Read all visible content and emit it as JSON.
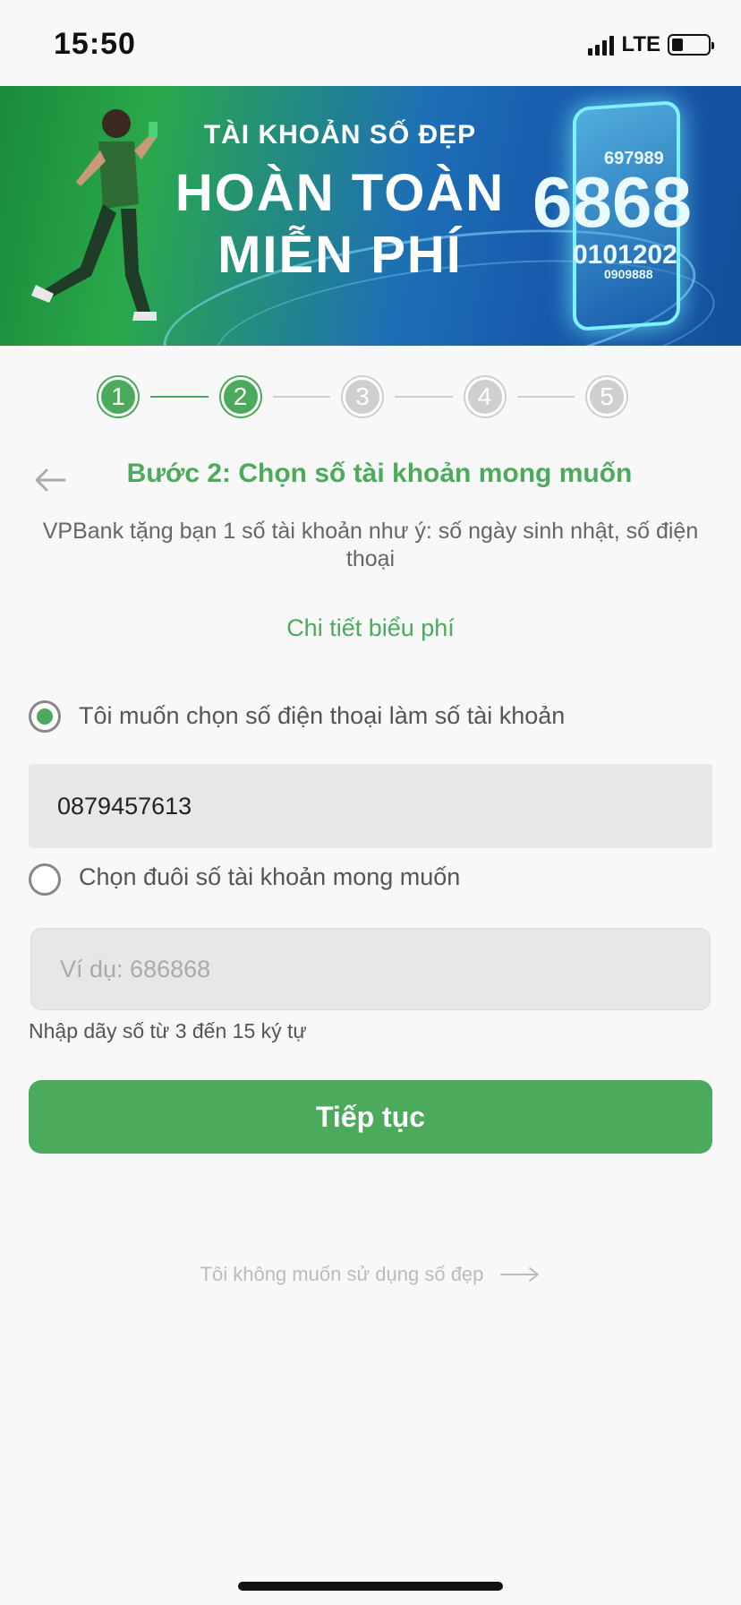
{
  "status_bar": {
    "time": "15:50",
    "network": "LTE"
  },
  "banner": {
    "line1": "TÀI KHOẢN SỐ ĐẸP",
    "line2": "HOÀN TOÀN",
    "line3": "MIỄN PHÍ",
    "numbers": [
      "697989",
      "6868",
      "0101202",
      "0909888"
    ]
  },
  "stepper": {
    "steps": [
      "1",
      "2",
      "3",
      "4",
      "5"
    ],
    "current_step": 2
  },
  "header": {
    "title": "Bước 2: Chọn số tài khoản mong muốn",
    "subtitle": "VPBank tặng bạn 1 số tài khoản như ý: số ngày sinh nhật, số điện thoại",
    "fee_link": "Chi tiết biểu phí"
  },
  "options": {
    "phone_option_label": "Tôi muốn chọn số điện thoại làm số tài khoản",
    "phone_value": "0879457613",
    "custom_option_label": "Chọn đuôi số tài khoản mong muốn",
    "custom_placeholder": "Ví dụ: 686868",
    "hint": "Nhập dãy số từ 3 đến 15 ký tự"
  },
  "actions": {
    "continue_label": "Tiếp tục",
    "skip_label": "Tôi không muốn sử dụng số đẹp"
  },
  "colors": {
    "accent": "#4caa5c",
    "inactive": "#cfcfcf"
  }
}
